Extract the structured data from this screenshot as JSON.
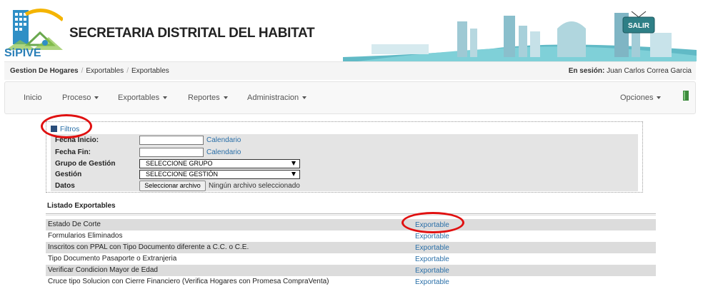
{
  "header": {
    "logo_text": "SiPIVE",
    "title": "SECRETARIA DISTRITAL DEL HABITAT",
    "logout_sign": "SALIR"
  },
  "breadcrumb": {
    "items": [
      "Gestion De Hogares",
      "Exportables",
      "Exportables"
    ]
  },
  "session": {
    "label": "En sesión:",
    "user": "Juan Carlos Correa Garcia"
  },
  "nav": {
    "items": [
      {
        "label": "Inicio",
        "dropdown": false
      },
      {
        "label": "Proceso",
        "dropdown": true
      },
      {
        "label": "Exportables",
        "dropdown": true
      },
      {
        "label": "Reportes",
        "dropdown": true
      },
      {
        "label": "Administracion",
        "dropdown": true
      }
    ],
    "options": "Opciones"
  },
  "filters": {
    "title": "Filtros",
    "fecha_inicio": {
      "label": "Fecha Inicio:",
      "value": "",
      "link": "Calendario"
    },
    "fecha_fin": {
      "label": "Fecha Fin:",
      "value": "",
      "link": "Calendario"
    },
    "grupo": {
      "label": "Grupo de Gestión",
      "selected": "SELECCIONE GRUPO"
    },
    "gestion": {
      "label": "Gestión",
      "selected": "SELECCIONE GESTIÓN"
    },
    "datos": {
      "label": "Datos",
      "button": "Seleccionar archivo",
      "status": "Ningún archivo seleccionado"
    }
  },
  "list": {
    "title": "Listado Exportables",
    "rows": [
      {
        "name": "Estado De Corte",
        "action": "Exportable"
      },
      {
        "name": "Formularios Eliminados",
        "action": "Exportable"
      },
      {
        "name": "Inscritos con PPAL con Tipo Documento diferente a C.C. o C.E.",
        "action": "Exportable"
      },
      {
        "name": "Tipo Documento Pasaporte o Extranjeria",
        "action": "Exportable"
      },
      {
        "name": "Verificar Condicion Mayor de Edad",
        "action": "Exportable"
      },
      {
        "name": "Cruce tipo Solucion con Cierre Financiero (Verifica Hogares con Promesa CompraVenta)",
        "action": "Exportable"
      }
    ]
  },
  "colors": {
    "link": "#2a6fa8",
    "annotation": "#e01010",
    "brand_teal": "#3aa9b8"
  }
}
